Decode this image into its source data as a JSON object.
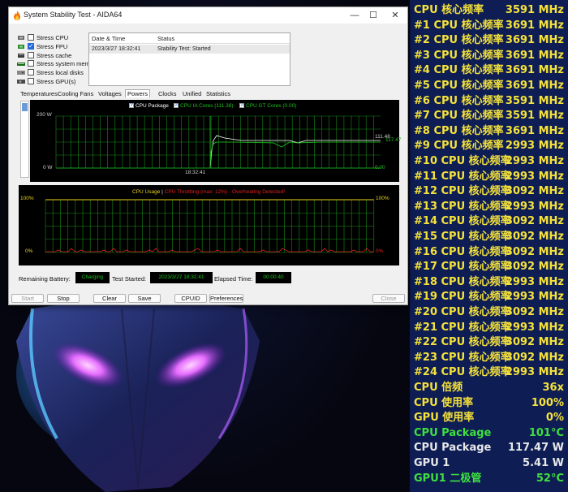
{
  "window": {
    "title": "System Stability Test - AIDA64",
    "minimize_glyph": "—",
    "maximize_glyph": "☐",
    "close_glyph": "✕"
  },
  "stress_options": [
    {
      "label": "Stress CPU",
      "checked": false,
      "icon": "cpu-icon"
    },
    {
      "label": "Stress FPU",
      "checked": true,
      "icon": "fpu-icon"
    },
    {
      "label": "Stress cache",
      "checked": false,
      "icon": "cache-icon"
    },
    {
      "label": "Stress system memory",
      "checked": false,
      "icon": "memory-icon"
    },
    {
      "label": "Stress local disks",
      "checked": false,
      "icon": "disk-icon"
    },
    {
      "label": "Stress GPU(s)",
      "checked": false,
      "icon": "gpu-icon"
    }
  ],
  "status_table": {
    "headers": [
      "Date & Time",
      "Status"
    ],
    "rows": [
      [
        "2023/3/27 18:32:41",
        "Stability Test: Started"
      ]
    ]
  },
  "tabs": [
    "Temperatures",
    "Cooling Fans",
    "Voltages",
    "Powers",
    "Clocks",
    "Unified",
    "Statistics"
  ],
  "active_tab": "Powers",
  "power_graph": {
    "legend": [
      {
        "label": "CPU Package",
        "color": "#ffffff"
      },
      {
        "label": "CPU IA Cores (111.38)",
        "color": "#1ec11e"
      },
      {
        "label": "CPU GT Cores (0.00)",
        "color": "#1ec11e"
      }
    ],
    "y_top": "200 W",
    "y_bottom": "0 W",
    "time_label": "18:32:41",
    "right_top": "111.48",
    "right_top2": "117.47",
    "right_bottom": "0.00",
    "grid_color": "#1a8a1a"
  },
  "usage_graph": {
    "title_usage": "CPU Usage",
    "title_sep": "|",
    "title_throttle": "CPU Throttling (max: 12%) - Overheating Detected!",
    "y_top_left": "100%",
    "y_bottom_left": "0%",
    "y_top_right": "100%",
    "y_bottom_right": "0%",
    "usage_color": "#e8d020",
    "throttle_color": "#e02020"
  },
  "bottom_bar": {
    "battery_label": "Remaining Battery:",
    "battery_value": "Charging",
    "started_label": "Test Started:",
    "started_value": "2023/3/27 18:32:41",
    "elapsed_label": "Elapsed Time:",
    "elapsed_value": "00:00:40"
  },
  "buttons": {
    "start": "Start",
    "stop": "Stop",
    "clear": "Clear",
    "save": "Save",
    "cpuid": "CPUID",
    "preferences": "Preferences",
    "close": "Close"
  },
  "osd": [
    {
      "label": "CPU 核心频率",
      "value": "3591 MHz",
      "color": "#f5e23a"
    },
    {
      "label": "#1 CPU 核心频率",
      "value": "3691 MHz",
      "color": "#f5e23a"
    },
    {
      "label": "#2 CPU 核心频率",
      "value": "3691 MHz",
      "color": "#f5e23a"
    },
    {
      "label": "#3 CPU 核心频率",
      "value": "3691 MHz",
      "color": "#f5e23a"
    },
    {
      "label": "#4 CPU 核心频率",
      "value": "3691 MHz",
      "color": "#f5e23a"
    },
    {
      "label": "#5 CPU 核心频率",
      "value": "3691 MHz",
      "color": "#f5e23a"
    },
    {
      "label": "#6 CPU 核心频率",
      "value": "3591 MHz",
      "color": "#f5e23a"
    },
    {
      "label": "#7 CPU 核心频率",
      "value": "3591 MHz",
      "color": "#f5e23a"
    },
    {
      "label": "#8 CPU 核心频率",
      "value": "3691 MHz",
      "color": "#f5e23a"
    },
    {
      "label": "#9 CPU 核心频率",
      "value": "2993 MHz",
      "color": "#f5e23a"
    },
    {
      "label": "#10 CPU 核心频率",
      "value": "2993 MHz",
      "color": "#f5e23a"
    },
    {
      "label": "#11 CPU 核心频率",
      "value": "2993 MHz",
      "color": "#f5e23a"
    },
    {
      "label": "#12 CPU 核心频率",
      "value": "3092 MHz",
      "color": "#f5e23a"
    },
    {
      "label": "#13 CPU 核心频率",
      "value": "2993 MHz",
      "color": "#f5e23a"
    },
    {
      "label": "#14 CPU 核心频率",
      "value": "3092 MHz",
      "color": "#f5e23a"
    },
    {
      "label": "#15 CPU 核心频率",
      "value": "3092 MHz",
      "color": "#f5e23a"
    },
    {
      "label": "#16 CPU 核心频率",
      "value": "3092 MHz",
      "color": "#f5e23a"
    },
    {
      "label": "#17 CPU 核心频率",
      "value": "3092 MHz",
      "color": "#f5e23a"
    },
    {
      "label": "#18 CPU 核心频率",
      "value": "2993 MHz",
      "color": "#f5e23a"
    },
    {
      "label": "#19 CPU 核心频率",
      "value": "2993 MHz",
      "color": "#f5e23a"
    },
    {
      "label": "#20 CPU 核心频率",
      "value": "3092 MHz",
      "color": "#f5e23a"
    },
    {
      "label": "#21 CPU 核心频率",
      "value": "2993 MHz",
      "color": "#f5e23a"
    },
    {
      "label": "#22 CPU 核心频率",
      "value": "3092 MHz",
      "color": "#f5e23a"
    },
    {
      "label": "#23 CPU 核心频率",
      "value": "3092 MHz",
      "color": "#f5e23a"
    },
    {
      "label": "#24 CPU 核心频率",
      "value": "2993 MHz",
      "color": "#f5e23a"
    },
    {
      "label": "CPU 倍频",
      "value": "36x",
      "color": "#f5e23a"
    },
    {
      "label": "CPU 使用率",
      "value": "100%",
      "color": "#f5e23a"
    },
    {
      "label": "GPU 使用率",
      "value": "0%",
      "color": "#f5e23a"
    },
    {
      "label": "CPU Package",
      "value": "101°C",
      "color": "#3fe03f"
    },
    {
      "label": "CPU Package",
      "value": "117.47 W",
      "color": "#e8e8e8"
    },
    {
      "label": "GPU 1",
      "value": "5.41 W",
      "color": "#e8e8e8"
    },
    {
      "label": "GPU1 二极管",
      "value": "52°C",
      "color": "#3fe03f"
    }
  ]
}
